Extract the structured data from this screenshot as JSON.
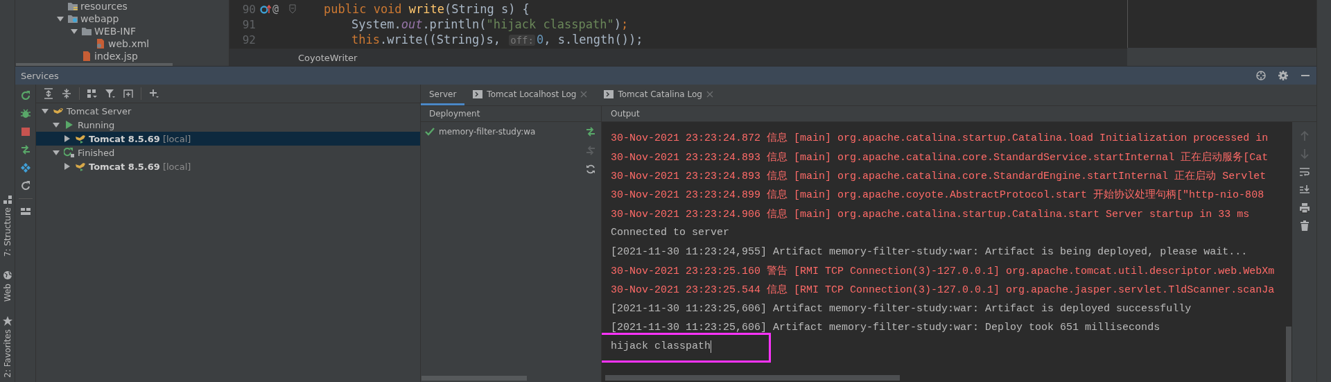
{
  "project_tree": {
    "items": [
      {
        "label": "resources",
        "kind": "resources-folder"
      },
      {
        "label": "webapp",
        "kind": "web-folder",
        "expanded": true,
        "children": [
          {
            "label": "WEB-INF",
            "kind": "folder",
            "expanded": true,
            "children": [
              {
                "label": "web.xml",
                "kind": "xml-file"
              }
            ]
          },
          {
            "label": "index.jsp",
            "kind": "jsp-file"
          }
        ]
      }
    ]
  },
  "editor": {
    "annotation_mark": "@",
    "lines": [
      {
        "number": "90",
        "tokens": [
          {
            "kind": "keyword",
            "text": "public void "
          },
          {
            "kind": "method",
            "text": "write"
          },
          {
            "kind": "plain",
            "text": "(String s) {"
          }
        ]
      },
      {
        "number": "91",
        "tokens": [
          {
            "kind": "plain",
            "text": "System."
          },
          {
            "kind": "field",
            "text": "out"
          },
          {
            "kind": "plain",
            "text": ".println("
          },
          {
            "kind": "string",
            "text": "\"hijack classpath\""
          },
          {
            "kind": "plain",
            "text": ")"
          },
          {
            "kind": "keyword",
            "text": ";"
          }
        ]
      },
      {
        "number": "92",
        "tokens": [
          {
            "kind": "keyword",
            "text": "this"
          },
          {
            "kind": "plain",
            "text": ".write(("
          },
          {
            "kind": "plain",
            "text": "String"
          },
          {
            "kind": "plain",
            "text": ")s, "
          },
          {
            "kind": "hint",
            "text": "off:"
          },
          {
            "kind": "number",
            "text": "0"
          },
          {
            "kind": "plain",
            "text": ", s.length());"
          }
        ]
      }
    ],
    "breadcrumb": "CoyoteWriter"
  },
  "services": {
    "title": "Services",
    "tree": [
      {
        "label": "Tomcat Server",
        "kind": "server",
        "expanded": true,
        "selected": false,
        "children": [
          {
            "label": "Running",
            "kind": "running",
            "expanded": true,
            "selected": false,
            "children": [
              {
                "label": "Tomcat 8.5.69",
                "suffix": "[local]",
                "kind": "tomcat",
                "expanded": false,
                "selected": true
              }
            ]
          },
          {
            "label": "Finished",
            "kind": "finished",
            "expanded": true,
            "selected": false,
            "children": [
              {
                "label": "Tomcat 8.5.69",
                "suffix": "[local]",
                "kind": "tomcat",
                "expanded": false,
                "selected": false
              }
            ]
          }
        ]
      }
    ],
    "tabs": [
      {
        "label": "Server",
        "kind": "server",
        "selected": true,
        "closable": false
      },
      {
        "label": "Tomcat Localhost Log",
        "kind": "log",
        "selected": false,
        "closable": true
      },
      {
        "label": "Tomcat Catalina Log",
        "kind": "log",
        "selected": false,
        "closable": true
      }
    ],
    "deployment": {
      "header": "Deployment",
      "items": [
        {
          "label": "memory-filter-study:wa",
          "deployed": true
        }
      ]
    },
    "output": {
      "header": "Output",
      "lines": [
        {
          "kind": "error",
          "text": "30-Nov-2021 23:23:24.872 信息 [main] org.apache.catalina.startup.Catalina.load Initialization processed in"
        },
        {
          "kind": "error",
          "text": "30-Nov-2021 23:23:24.893 信息 [main] org.apache.catalina.core.StandardService.startInternal 正在启动服务[Cat"
        },
        {
          "kind": "error",
          "text": "30-Nov-2021 23:23:24.893 信息 [main] org.apache.catalina.core.StandardEngine.startInternal 正在启动 Servlet"
        },
        {
          "kind": "error",
          "text": "30-Nov-2021 23:23:24.899 信息 [main] org.apache.coyote.AbstractProtocol.start 开始协议处理句柄[\"http-nio-808"
        },
        {
          "kind": "error",
          "text": "30-Nov-2021 23:23:24.906 信息 [main] org.apache.catalina.startup.Catalina.start Server startup in 33 ms"
        },
        {
          "kind": "normal",
          "text": "Connected to server"
        },
        {
          "kind": "normal",
          "text": "[2021-11-30 11:23:24,955] Artifact memory-filter-study:war: Artifact is being deployed, please wait..."
        },
        {
          "kind": "error",
          "text": "30-Nov-2021 23:23:25.160 警告 [RMI TCP Connection(3)-127.0.0.1] org.apache.tomcat.util.descriptor.web.WebXm"
        },
        {
          "kind": "error",
          "text": "30-Nov-2021 23:23:25.544 信息 [RMI TCP Connection(3)-127.0.0.1] org.apache.jasper.servlet.TldScanner.scanJa"
        },
        {
          "kind": "normal",
          "text": "[2021-11-30 11:23:25,606] Artifact memory-filter-study:war: Artifact is deployed successfully"
        },
        {
          "kind": "normal",
          "text": "[2021-11-30 11:23:25,606] Artifact memory-filter-study:war: Deploy took 651 milliseconds"
        },
        {
          "kind": "input",
          "text": "hijack classpath",
          "highlighted": true
        }
      ]
    }
  },
  "side_tabs": [
    {
      "label": "7: Structure",
      "kind": "structure"
    },
    {
      "label": "Web",
      "kind": "web"
    },
    {
      "label": "2: Favorites",
      "kind": "favorites"
    }
  ]
}
